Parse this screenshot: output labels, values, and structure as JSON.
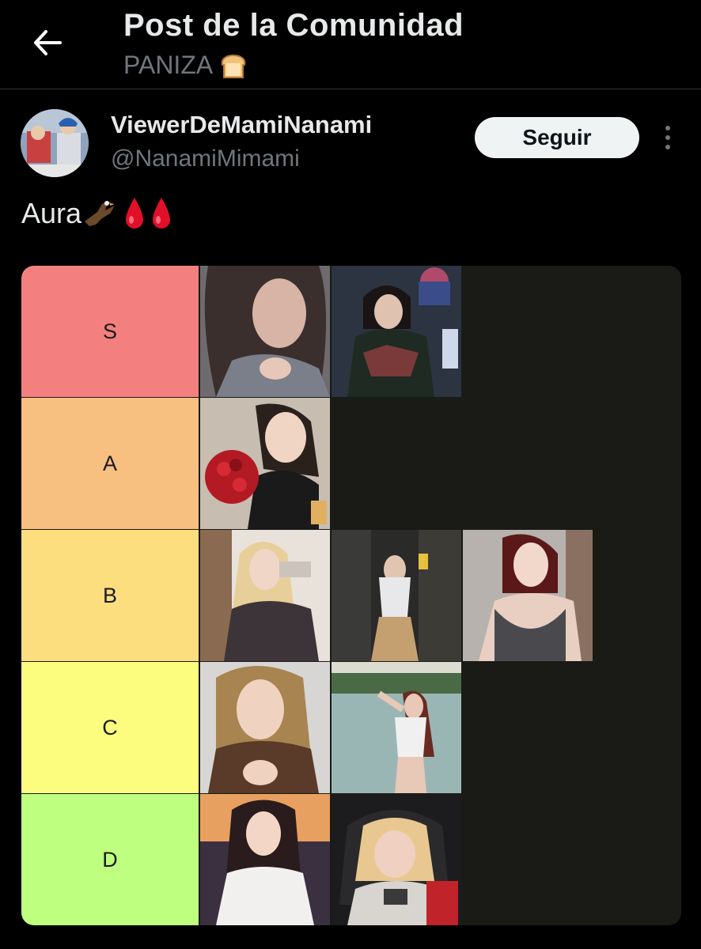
{
  "header": {
    "title": "Post de la Comunidad",
    "community": "PANIZA",
    "community_icon": "bread-icon"
  },
  "post": {
    "display_name": "ViewerDeMamiNanami",
    "handle": "@NanamiMimami",
    "follow_label": "Seguir",
    "text": "Aura",
    "emoji": [
      "eagle-icon",
      "drop-of-blood-icon",
      "drop-of-blood-icon"
    ]
  },
  "tier_list": {
    "rows": [
      {
        "label": "S",
        "color": "#f47f7f",
        "images": 2
      },
      {
        "label": "A",
        "color": "#f7bf80",
        "images": 1
      },
      {
        "label": "B",
        "color": "#fcde7f",
        "images": 3
      },
      {
        "label": "C",
        "color": "#fcfd7f",
        "images": 2
      },
      {
        "label": "D",
        "color": "#beff7f",
        "images": 2
      }
    ]
  },
  "colors": {
    "background": "#000000",
    "text_primary": "#e7e9ea",
    "text_secondary": "#71767b",
    "button_bg": "#eff3f4",
    "tier_empty": "#1a1a17"
  }
}
